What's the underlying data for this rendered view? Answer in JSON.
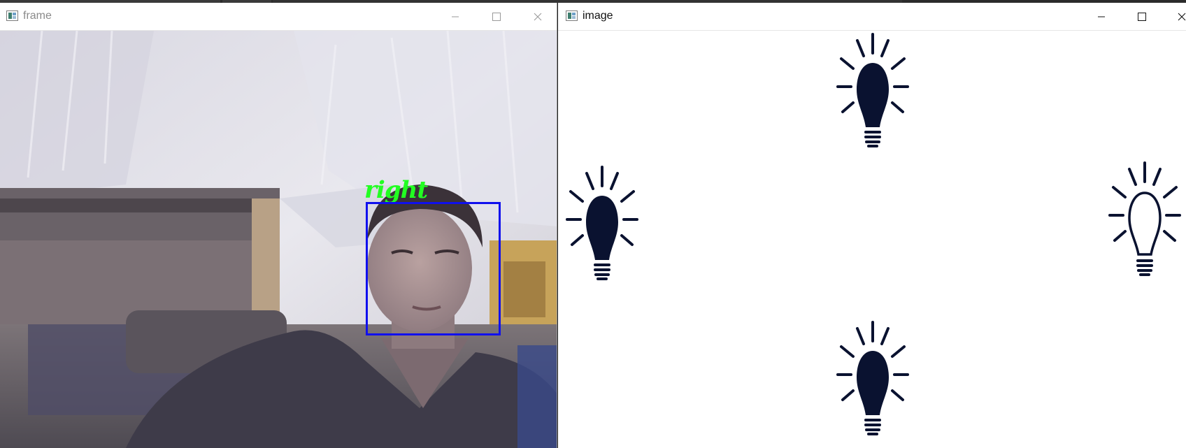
{
  "windows": {
    "frame": {
      "title": "frame",
      "overlay_label": "right",
      "box_color": "#1010ee",
      "label_color": "#22ff22",
      "controls": [
        "minimize-icon",
        "maximize-icon",
        "close-icon"
      ]
    },
    "image": {
      "title": "image",
      "controls": [
        "minimize-icon",
        "maximize-icon",
        "close-icon"
      ],
      "bulbs": [
        {
          "position": "top",
          "state": "filled"
        },
        {
          "position": "left",
          "state": "filled"
        },
        {
          "position": "right",
          "state": "outline"
        },
        {
          "position": "bottom",
          "state": "filled"
        }
      ],
      "bulb_color": "#0a1230"
    }
  }
}
